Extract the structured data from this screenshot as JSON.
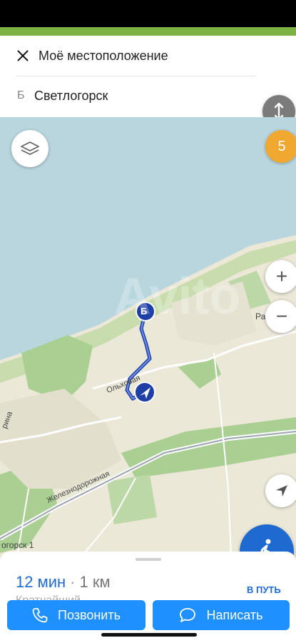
{
  "route": {
    "from_text": "Моё местоположение",
    "to_letter": "Б",
    "to_text": "Светлогорск"
  },
  "map": {
    "badge_count": "5",
    "zoom_in": "+",
    "zoom_out": "−",
    "labels": {
      "olhovaya": "Ольховая",
      "zheleznodorozhnaya": "Железнодорожная",
      "station": "огорск 1",
      "rina": "рина",
      "ra": "Ра"
    },
    "pin_b_letter": "Б",
    "watermark": "Avito"
  },
  "sheet": {
    "eta_time": "12 мин",
    "eta_separator": "·",
    "eta_distance": "1 км",
    "route_type": "Кратчайший",
    "go_label": "В ПУТЬ"
  },
  "actions": {
    "call_label": "Позвонить",
    "message_label": "Написать"
  },
  "colors": {
    "accent_blue": "#1e90ff",
    "route_blue": "#1e3fa6",
    "badge_orange": "#f0a830",
    "status_green": "#7cb342",
    "sea": "#b9d6df"
  }
}
